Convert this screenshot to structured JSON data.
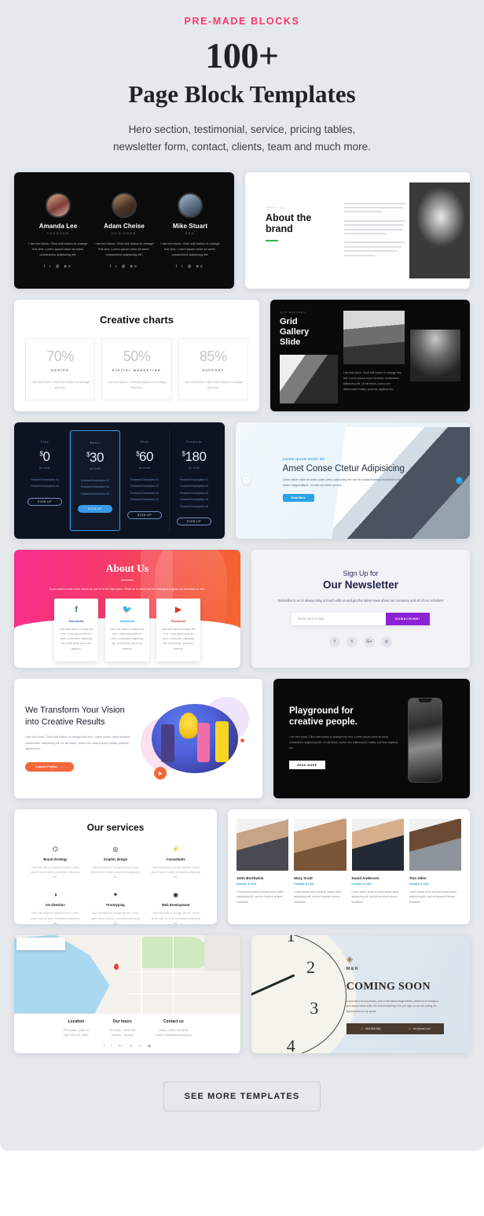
{
  "header": {
    "eyebrow": "PRE-MADE BLOCKS",
    "count": "100+",
    "title": "Page Block Templates",
    "subtitle_line1": "Hero section, testimonial, service, pricing tables,",
    "subtitle_line2": "newsletter form, contact, clients, team and much more."
  },
  "team_card": {
    "members": [
      {
        "name": "Amanda Lee",
        "role": "FOUNDER",
        "text": "I am text block. Click edit button to change this text. Lorem ipsum dolor sit amet, consectetur adipiscing elit.",
        "social": "f  t  @  Be"
      },
      {
        "name": "Adam Cheise",
        "role": "DESIGNER",
        "text": "I am text block. Click edit button to change this text. Lorem ipsum dolor sit amet, consectetur adipiscing elit.",
        "social": "f  t  @  Be"
      },
      {
        "name": "Mike Stuart",
        "role": "SEO",
        "text": "I am text block. Click edit button to change this text. Lorem ipsum dolor sit amet, consectetur adipiscing elit.",
        "social": "f  t  @  Be"
      }
    ]
  },
  "brand_card": {
    "eyebrow": "ABOUT US",
    "title_line1": "About the",
    "title_line2": "brand"
  },
  "charts_card": {
    "title": "Creative charts",
    "items": [
      {
        "percent": "70%",
        "label": "DESIGN",
        "text": "I am text block. Click edit button to change this text."
      },
      {
        "percent": "50%",
        "label": "DIGITAL MARKETING",
        "text": "I am text block. Click edit button to change this text."
      },
      {
        "percent": "85%",
        "label": "SUPPORT",
        "text": "I am text block. Click edit button to change this text."
      }
    ]
  },
  "gallery_card": {
    "eyebrow": "OUR GALLERY",
    "title_line1": "Grid",
    "title_line2": "Gallery",
    "title_line3": "Slide",
    "text": "I am text block. Click edit button to change this text. Lorem ipsum dolor sit amet, consectetur adipiscing elit. Ut elit tellus, luctus nec ullamcorper mattis, pulvinar dapibus leo."
  },
  "pricing_card": {
    "plans": [
      {
        "name": "Free",
        "currency": "$",
        "price": "0",
        "per": "per month",
        "features": [
          "Featured Description #1",
          "Featured Description #2"
        ],
        "button": "SIGN UP",
        "highlight": false
      },
      {
        "name": "Basic",
        "currency": "$",
        "price": "30",
        "per": "per month",
        "features": [
          "Featured Description #1",
          "Featured Description #2",
          "Featured Description #3"
        ],
        "button": "SIGN UP",
        "highlight": true
      },
      {
        "name": "Plus",
        "currency": "$",
        "price": "60",
        "per": "per month",
        "features": [
          "Featured Description #1",
          "Featured Description #2",
          "Featured Description #3",
          "Featured Description #4"
        ],
        "button": "SIGN UP",
        "highlight": false
      },
      {
        "name": "Premium",
        "currency": "$",
        "price": "180",
        "per": "per month",
        "features": [
          "Featured Description #1",
          "Featured Description #2",
          "Featured Description #3",
          "Featured Description #4",
          "Featured Description #5"
        ],
        "button": "SIGN UP",
        "highlight": false
      }
    ]
  },
  "hero_card": {
    "eyebrow": "Lorem Ipsum Dolor Sit",
    "title": "Amet Conse Ctetur Adipisicing",
    "text": "Lorem ipsum dolor sit amet conse ctetur adipisicing elit, sed do eiusmod tempor incididunt ut labore et dolore magna aliqua. Ut enim ad minim veniam.",
    "button": "Read More",
    "arrow_prev": "‹",
    "arrow_next": "›"
  },
  "about_card": {
    "title": "About Us",
    "text": "If you want to learn more about us, you're in the right place. Read on to learn how we managed to grow our business so fast.",
    "items": [
      {
        "icon": "f",
        "name": "Facebook",
        "text": "Click edit button to change this text. Lorem ipsum dolor sit amet, consectetur adipiscing elit. Ut elit tellus, luctus nec ullamcor."
      },
      {
        "icon": "🐦",
        "name": "Facebook",
        "text": "Click edit button to change this text. Lorem ipsum dolor sit amet, consectetur adipiscing elit. Ut elit tellus, luctus nec ullamcor."
      },
      {
        "icon": "▶",
        "name": "Facebook",
        "text": "Click edit button to change this text. Lorem ipsum dolor sit amet, consectetur adipiscing elit. Ut elit tellus, luctus nec ullamcor."
      }
    ]
  },
  "newsletter_card": {
    "small": "Sign Up for",
    "title": "Our Newsletter",
    "text": "Subscribe to us to always stay in touch with us and get the latest news about our company and all of our activities!",
    "placeholder": "Enter your e-mail",
    "button": "SUBSCRIBE!",
    "socials": [
      "f",
      "t",
      "G+",
      "◎"
    ]
  },
  "vision_card": {
    "title_line1": "We Transform Your Vision",
    "title_line2": "into Creative Results",
    "text": "I am text block. Click edit button to change this text. Lorem ipsum dolor sit amet, consectetur adipiscing elit. Ut elit tellus, luctus nec ullamcorper mattis, pulvinar dapibus leo.",
    "button": "Launch Project",
    "button_arrow": "→",
    "play_icon": "▶"
  },
  "playground_card": {
    "title_line1": "Playground for",
    "title_line2": "creative people.",
    "text": "I am text block. Click edit button to change this text. Lorem ipsum dolor sit amet, consectetur adipiscing elit. Ut elit tellus, luctus nec ullamcorper mattis, pulvinar dapibus leo.",
    "button": "READ MORE"
  },
  "services_card": {
    "title": "Our services",
    "items": [
      {
        "icon": "⌬",
        "name": "Brand Strategy",
        "text": "Click edit button to change this text. Lorem ipsum dolor sit amet, consectetur adipiscing elit."
      },
      {
        "icon": "◎",
        "name": "Graphic design",
        "text": "Click edit button to change this text. Lorem ipsum dolor sit amet, consectetur adipiscing elit."
      },
      {
        "icon": "⚡",
        "name": "Consultants",
        "text": "Click edit button to change this text. Lorem ipsum dolor sit amet, consectetur adipiscing elit."
      },
      {
        "icon": "◑",
        "name": "Art direction",
        "text": "Click edit button to change this text. Lorem ipsum dolor sit amet, consectetur adipiscing elit."
      },
      {
        "icon": "✦",
        "name": "Prototyping",
        "text": "Click edit button to change this text. Lorem ipsum dolor sit amet, consectetur adipiscing elit."
      },
      {
        "icon": "◉",
        "name": "Web development",
        "text": "Click edit button to change this text. Lorem ipsum dolor sit amet, consectetur adipiscing elit."
      }
    ]
  },
  "people_card": {
    "members": [
      {
        "name": "John Borthwick",
        "role": "Founder & CEO",
        "text": "Lorem ipsum dolor sit amet conse ctetur adipisicing elit, sed do eiusmod tempor incididunt."
      },
      {
        "name": "Mary Scott",
        "role": "Founder & CEO",
        "text": "Lorem ipsum dolor sit amet conse ctetur adipisicing elit, sed do eiusmod tempor incididunt."
      },
      {
        "name": "David Anderson",
        "role": "Founder & CEO",
        "text": "Lorem ipsum dolor sit amet conse ctetur adipisicing elit, sed do eiusmod tempor incididunt."
      },
      {
        "name": "Tom Allen",
        "role": "Founder & CEO",
        "text": "Lorem ipsum dolor sit amet conse ctetur adipisicing elit, sed do eiusmod tempor incididunt."
      }
    ]
  },
  "map_card": {
    "columns": [
      {
        "heading": "Location",
        "line1": "795 Victoria Queen St",
        "line2": "New York, NY 10018"
      },
      {
        "heading": "Our hours",
        "line1": "10:00 AM – 05:00 PM",
        "line2": "Monday – Sunday"
      },
      {
        "heading": "Contact us",
        "line1": "Phone: 1-800-756-64-56",
        "line2": "Email: contact@company.com"
      }
    ],
    "socials": [
      "f",
      "t",
      "G+",
      "◎",
      "in",
      "▣"
    ]
  },
  "coming_soon_card": {
    "diamond_icon": "◈",
    "brand": "M&R",
    "title": "COMING SOON",
    "text": "A new line of luxury jewelry, built on the latest design trends, tailored to fit exactly to your exact collect while. We want everything to be just right, so we are putting the final touches on our epeek.",
    "phone_icon": "✆",
    "phone": "888-888-888",
    "email_icon": "✉",
    "email": "info@mail.com"
  },
  "footer": {
    "button": "SEE MORE TEMPLATES"
  },
  "colors": {
    "accent_pink": "#f8376b",
    "page_bg": "#e6e9ec",
    "pricing_blue": "#3d9ae8",
    "newsletter_purple": "#8b22d6",
    "orange": "#f2683c"
  }
}
